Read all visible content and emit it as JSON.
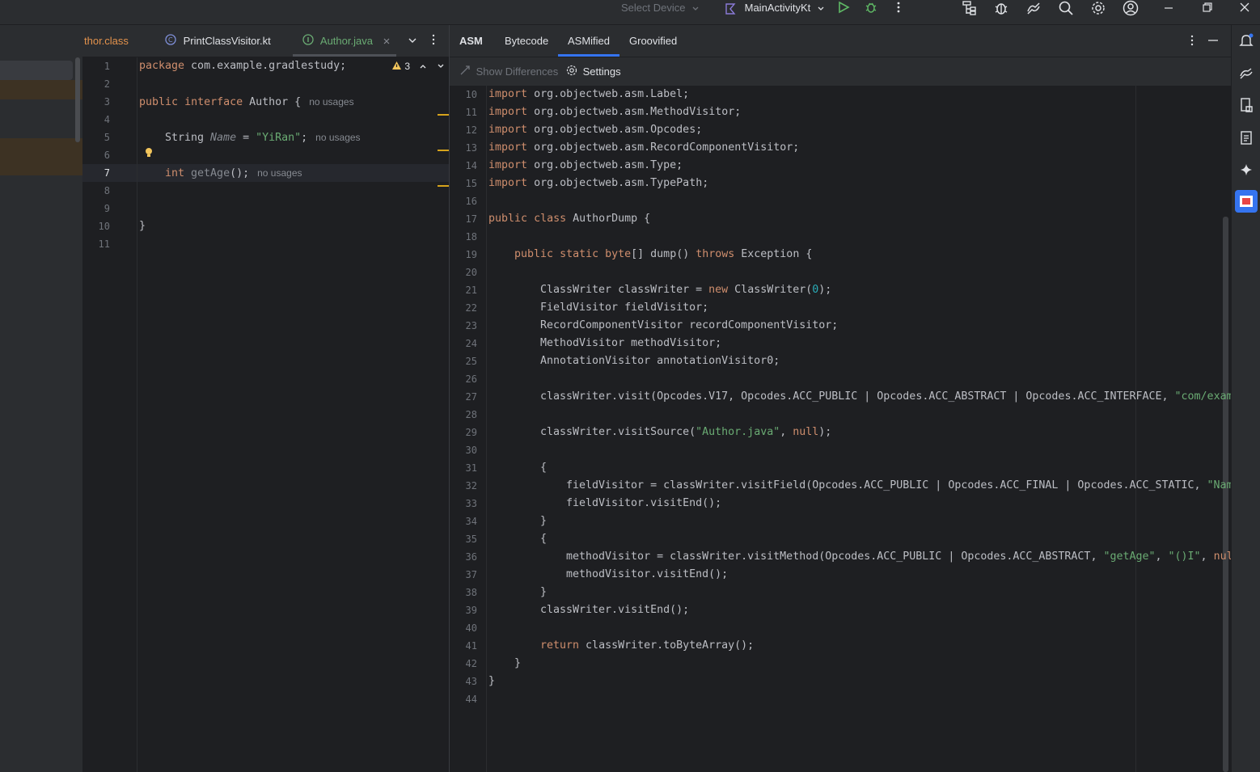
{
  "topbar": {
    "device_selector": "Select Device",
    "run_config": "MainActivityKt"
  },
  "editor_tabs": [
    {
      "label": "thor.class",
      "active": false
    },
    {
      "label": "PrintClassVisitor.kt",
      "active": false
    },
    {
      "label": "Author.java",
      "active": true
    }
  ],
  "editor": {
    "warning_count": "3",
    "line_numbers": [
      "1",
      "2",
      "3",
      "4",
      "5",
      "6",
      "7",
      "8",
      "9",
      "10",
      "11"
    ],
    "lines": {
      "l1_kw": "package",
      "l1_rest": " com.example.gradlestudy;",
      "l3_kw1": "public",
      "l3_kw2": "interface",
      "l3_name": " Author",
      "l3_rest": " {",
      "l3_hint": "no usages",
      "l5_type": "String ",
      "l5_field": "Name",
      "l5_eq": " = ",
      "l5_str": "\"YiRan\"",
      "l5_end": ";",
      "l5_hint": "no usages",
      "l7_kw": "int",
      "l7_method": " getAge",
      "l7_end": "();",
      "l7_hint": "no usages",
      "l10": "}"
    }
  },
  "right_tabs": [
    {
      "label": "ASM",
      "active": false,
      "bold": true
    },
    {
      "label": "Bytecode",
      "active": false
    },
    {
      "label": "ASMified",
      "active": true
    },
    {
      "label": "Groovified",
      "active": false
    }
  ],
  "toolbar": {
    "show_differences": "Show Differences",
    "settings": "Settings"
  },
  "asm_code": {
    "line_numbers": [
      "10",
      "11",
      "12",
      "13",
      "14",
      "15",
      "16",
      "17",
      "18",
      "19",
      "20",
      "21",
      "22",
      "23",
      "24",
      "25",
      "26",
      "27",
      "28",
      "29",
      "30",
      "31",
      "32",
      "33",
      "34",
      "35",
      "36",
      "37",
      "38",
      "39",
      "40",
      "41",
      "42",
      "43",
      "44"
    ],
    "l10": "org.objectweb.asm.Label;",
    "l11": "org.objectweb.asm.MethodVisitor;",
    "l12": "org.objectweb.asm.Opcodes;",
    "l13": "org.objectweb.asm.RecordComponentVisitor;",
    "l14": "org.objectweb.asm.Type;",
    "l15": "org.objectweb.asm.TypePath;",
    "import_kw": "import",
    "public_kw": "public",
    "class_kw": "class",
    "class_name": " AuthorDump {",
    "static_kw": "static",
    "byte_kw": "byte",
    "l19_rest": "[] dump() ",
    "throws_kw": "throws",
    "l19_end": " Exception {",
    "l21_a": "ClassWriter classWriter = ",
    "new_kw": "new",
    "l21_b": " ClassWriter(",
    "l21_num": "0",
    "l21_c": ");",
    "l22": "FieldVisitor fieldVisitor;",
    "l23": "RecordComponentVisitor recordComponentVisitor;",
    "l24": "MethodVisitor methodVisitor;",
    "l25": "AnnotationVisitor annotationVisitor0;",
    "l27_a": "classWriter.visit(Opcodes.V17, Opcodes.ACC_PUBLIC | Opcodes.ACC_ABSTRACT | Opcodes.ACC_INTERFACE, ",
    "l27_str": "\"com/exam",
    "l29_a": "classWriter.visitSource(",
    "l29_str": "\"Author.java\"",
    "l29_b": ", ",
    "null_kw": "null",
    "l29_c": ");",
    "open_brace": "{",
    "close_brace": "}",
    "l32_a": "fieldVisitor = classWriter.visitField(Opcodes.ACC_PUBLIC | Opcodes.ACC_FINAL | Opcodes.ACC_STATIC, ",
    "l32_str": "\"Nam",
    "l33": "fieldVisitor.visitEnd();",
    "l36_a": "methodVisitor = classWriter.visitMethod(Opcodes.ACC_PUBLIC | Opcodes.ACC_ABSTRACT, ",
    "l36_str1": "\"getAge\"",
    "l36_b": ", ",
    "l36_str2": "\"()I\"",
    "l36_c": ", ",
    "l36_null": "nul",
    "l37": "methodVisitor.visitEnd();",
    "l39": "classWriter.visitEnd();",
    "return_kw": "return",
    "l41_rest": " classWriter.toByteArray();"
  },
  "colors": {
    "background": "#1e1f22",
    "panel": "#2b2d30",
    "keyword": "#cf8e6d",
    "string": "#6aab73",
    "field": "#c77dbb",
    "number": "#2aacb8",
    "accent": "#3574f0"
  },
  "icons": [
    "chevron-down-icon",
    "run-icon",
    "debug-icon",
    "more-vertical-icon",
    "profile-icon",
    "bug-icon",
    "sync-icon",
    "search-icon",
    "settings-icon",
    "account-icon",
    "minimize-icon",
    "restore-icon",
    "close-icon",
    "notifications-icon",
    "gradle-icon",
    "device-manager-icon",
    "clipboard-icon",
    "gemini-icon",
    "plugin-icon",
    "lightbulb-icon",
    "warning-icon"
  ]
}
